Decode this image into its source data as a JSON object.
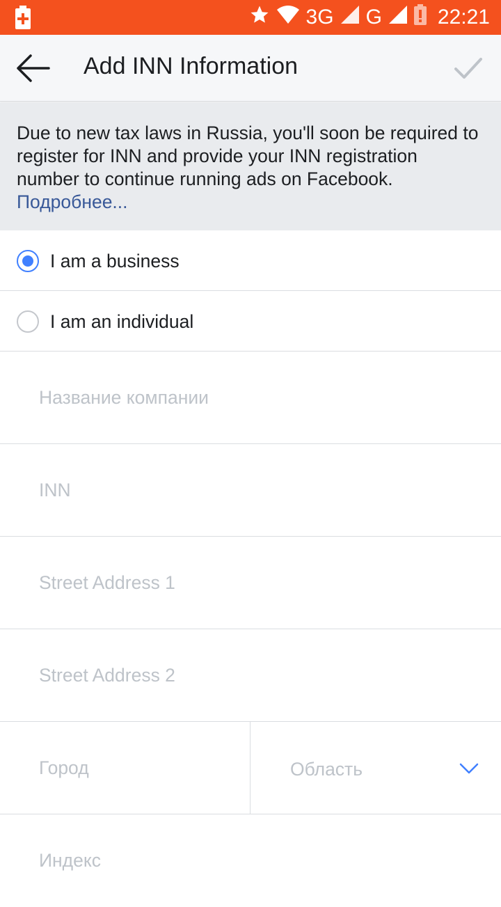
{
  "status_bar": {
    "network_3g": "3G",
    "network_g": "G",
    "time": "22:21",
    "color": "#f4511e"
  },
  "app_bar": {
    "title": "Add INN Information",
    "back_icon": "arrow-left-icon",
    "confirm_icon": "check-icon"
  },
  "notice": {
    "text": "Due to new tax laws in Russia, you'll soon be required to register for INN and provide your INN registration number to continue running ads on Facebook.",
    "link": "Подробнее..."
  },
  "entity_type": {
    "options": [
      {
        "label": "I am a business",
        "selected": true
      },
      {
        "label": "I am an individual",
        "selected": false
      }
    ]
  },
  "form": {
    "company_name": {
      "placeholder": "Название компании",
      "value": ""
    },
    "inn": {
      "placeholder": "INN",
      "value": ""
    },
    "street1": {
      "placeholder": "Street Address 1",
      "value": ""
    },
    "street2": {
      "placeholder": "Street Address 2",
      "value": ""
    },
    "city": {
      "placeholder": "Город",
      "value": ""
    },
    "region": {
      "placeholder": "Область"
    },
    "zip": {
      "placeholder": "Индекс",
      "value": ""
    }
  },
  "colors": {
    "accent": "#4080ff",
    "link": "#385898",
    "placeholder": "#bec3c9"
  }
}
